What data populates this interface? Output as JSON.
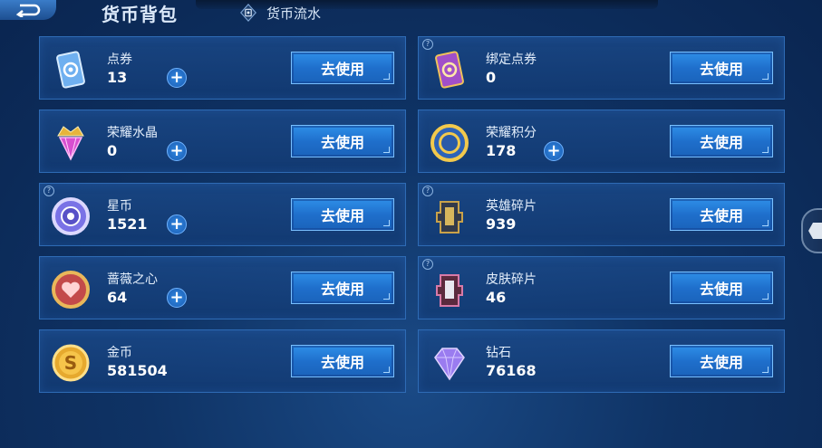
{
  "header": {
    "title": "货币背包",
    "flow_label": "货币流水"
  },
  "currencies": [
    {
      "name": "点券",
      "amount": "13",
      "icon": "coupon-card-icon",
      "has_plus": true,
      "has_help": false,
      "button": "去使用"
    },
    {
      "name": "绑定点券",
      "amount": "0",
      "icon": "bound-coupon-card-icon",
      "has_plus": false,
      "has_help": true,
      "button": "去使用"
    },
    {
      "name": "荣耀水晶",
      "amount": "0",
      "icon": "honor-crystal-icon",
      "has_plus": true,
      "has_help": false,
      "button": "去使用"
    },
    {
      "name": "荣耀积分",
      "amount": "178",
      "icon": "honor-points-icon",
      "has_plus": true,
      "has_help": false,
      "button": "去使用"
    },
    {
      "name": "星币",
      "amount": "1521",
      "icon": "star-coin-icon",
      "has_plus": true,
      "has_help": true,
      "button": "去使用"
    },
    {
      "name": "英雄碎片",
      "amount": "939",
      "icon": "hero-fragment-icon",
      "has_plus": false,
      "has_help": true,
      "button": "去使用"
    },
    {
      "name": "蔷薇之心",
      "amount": "64",
      "icon": "rose-heart-icon",
      "has_plus": true,
      "has_help": false,
      "button": "去使用"
    },
    {
      "name": "皮肤碎片",
      "amount": "46",
      "icon": "skin-fragment-icon",
      "has_plus": false,
      "has_help": true,
      "button": "去使用"
    },
    {
      "name": "金币",
      "amount": "581504",
      "icon": "gold-coin-icon",
      "has_plus": false,
      "has_help": false,
      "button": "去使用"
    },
    {
      "name": "钻石",
      "amount": "76168",
      "icon": "diamond-icon",
      "has_plus": false,
      "has_help": false,
      "button": "去使用"
    }
  ],
  "colors": {
    "background": "#0f3365",
    "card": "#1a4887",
    "card_border": "#2e6bb5",
    "button": "#2e8fe8",
    "button_border": "#79c0ff"
  }
}
